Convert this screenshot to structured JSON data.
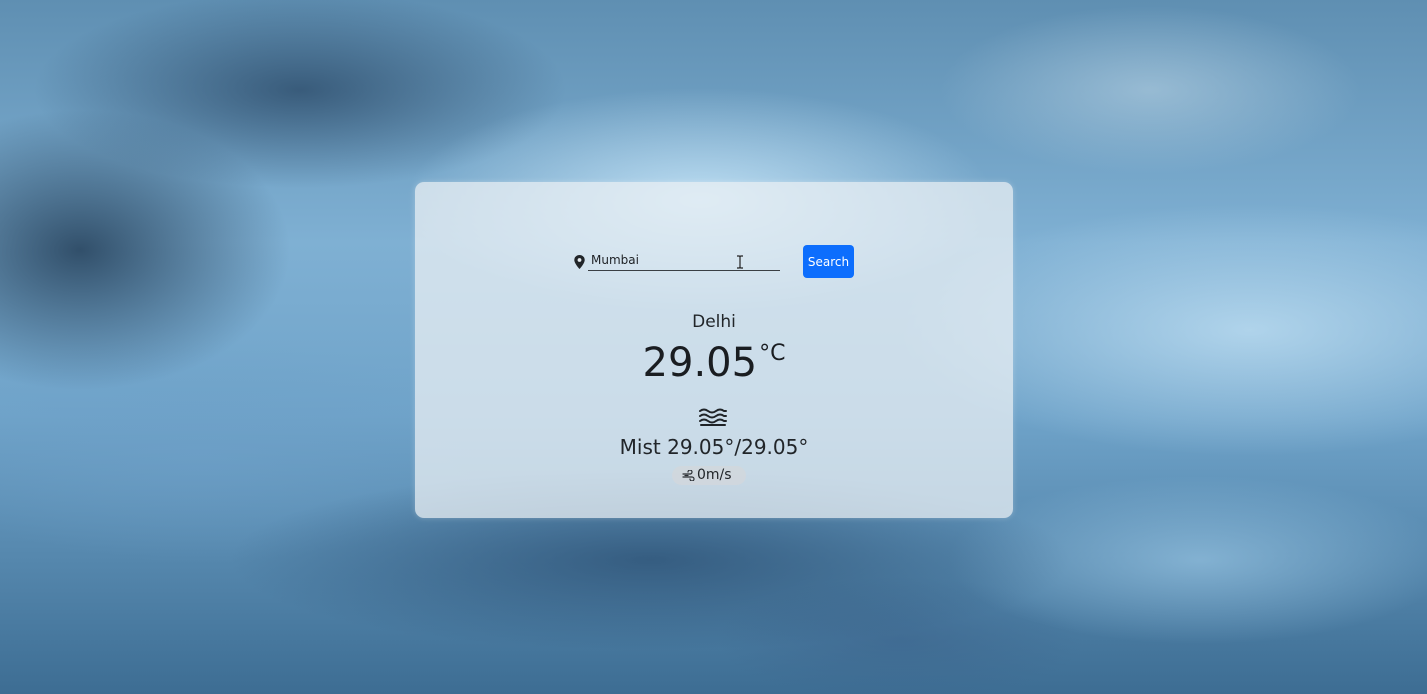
{
  "search": {
    "value": "Mumbai",
    "button_label": "Search"
  },
  "weather": {
    "city": "Delhi",
    "temperature": "29.05",
    "temperature_unit": "°C",
    "condition": "Mist",
    "min_max": "29.05°/29.05°",
    "wind_speed": "0m/s"
  },
  "icons": {
    "location": "map-pin-icon",
    "text_cursor": "text-cursor-icon",
    "condition": "mist-icon",
    "wind": "wind-icon"
  },
  "colors": {
    "accent": "#0d6efd",
    "card_background": "rgba(235,240,244,0.74)",
    "text": "#212529"
  }
}
